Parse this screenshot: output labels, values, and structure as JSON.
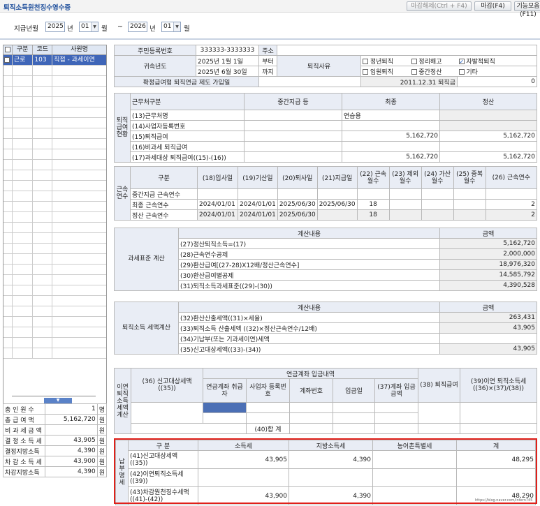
{
  "title": "퇴직소득원천징수영수증",
  "buttons": {
    "cancel_close": "마감해제(Ctrl + F4)",
    "close": "마감(F4)",
    "functions": "기능모음(F11)"
  },
  "period": {
    "label": "지급년월",
    "from_year": "2025",
    "year_unit": "년",
    "from_month": "01",
    "month_unit": "월",
    "tilde": "~",
    "to_year": "2026",
    "to_month": "01"
  },
  "list": {
    "headers": [
      "구분",
      "코드",
      "사원명"
    ],
    "rows": [
      {
        "type": "근로",
        "code": "103",
        "name": "직접 - 과세이연"
      }
    ]
  },
  "summary": [
    {
      "label": "총 인 원 수",
      "value": "1",
      "unit": "명"
    },
    {
      "label": "총 급 여 액",
      "value": "5,162,720",
      "unit": "원"
    },
    {
      "label": "비 과 세 금 액",
      "value": "",
      "unit": "원"
    },
    {
      "label": "결 정 소 득 세",
      "value": "43,905",
      "unit": "원"
    },
    {
      "label": "결정지방소득",
      "value": "4,390",
      "unit": "원"
    },
    {
      "label": "차 감 소 득 세",
      "value": "43,900",
      "unit": "원"
    },
    {
      "label": "차감지방소득",
      "value": "4,390",
      "unit": "원"
    }
  ],
  "top": {
    "resident_no_label": "주민등록번호",
    "resident_no": "333333-3333333",
    "address_label": "주소",
    "year_label": "귀속년도",
    "start_date": "2025년 1월 1일",
    "start_suffix": "부터",
    "end_date": "2025년 6월 30일",
    "end_suffix": "까지",
    "reason_label": "퇴직사유",
    "reasons": [
      {
        "label": "정년퇴직",
        "checked": false
      },
      {
        "label": "정리해고",
        "checked": false
      },
      {
        "label": "자발적퇴직",
        "checked": true
      },
      {
        "label": "임원퇴직",
        "checked": false
      },
      {
        "label": "중간정산",
        "checked": false
      },
      {
        "label": "기타",
        "checked": false
      }
    ],
    "pension_label": "확정급여형 퇴직연금 제도 가입일",
    "pension_date_text": "2011.12.31 퇴직금",
    "pension_amount": "0"
  },
  "status": {
    "side": "퇴직급여현황",
    "h_workplace": "근무처구분",
    "h_interim": "중간지급 등",
    "h_final": "최종",
    "h_settle": "정산",
    "rows": [
      {
        "label": "(13)근무처명",
        "interim": "",
        "final": "연습용",
        "settle": ""
      },
      {
        "label": "(14)사업자등록번호",
        "interim": "",
        "final": "",
        "settle": ""
      },
      {
        "label": "(15)퇴직급여",
        "interim": "",
        "final": "5,162,720",
        "settle": "5,162,720"
      },
      {
        "label": "(16)비과세 퇴직급여",
        "interim": "",
        "final": "",
        "settle": ""
      },
      {
        "label": "(17)과세대상 퇴직급여((15)-(16))",
        "interim": "",
        "final": "5,162,720",
        "settle": "5,162,720"
      }
    ]
  },
  "tenure": {
    "side": "근속연수",
    "h_category": "구분",
    "cols": [
      "(18)입사일",
      "(19)기산일",
      "(20)퇴사일",
      "(21)지급일",
      "(22) 근속월수",
      "(23) 제외월수",
      "(24) 가산월수",
      "(25) 중복월수",
      "(26) 근속연수"
    ],
    "rows": [
      {
        "label": "중간지급 근속연수",
        "vals": [
          "",
          "",
          "",
          "",
          "",
          "",
          "",
          "",
          ""
        ]
      },
      {
        "label": "최종 근속연수",
        "vals": [
          "2024/01/01",
          "2024/01/01",
          "2025/06/30",
          "2025/06/30",
          "18",
          "",
          "",
          "",
          "2"
        ]
      },
      {
        "label": "정산 근속연수",
        "vals": [
          "2024/01/01",
          "2024/01/01",
          "2025/06/30",
          "",
          "18",
          "",
          "",
          "",
          "2"
        ]
      }
    ]
  },
  "taxbase": {
    "side": "과세표준 계산",
    "h_content": "계산내용",
    "h_amount": "금액",
    "rows": [
      {
        "label": "(27)정산퇴직소득=(17)",
        "amount": "5,162,720"
      },
      {
        "label": "(28)근속연수공제",
        "amount": "2,000,000"
      },
      {
        "label": "(29)환산급여[(27-28)X12배/정산근속연수]",
        "amount": "18,976,320"
      },
      {
        "label": "(30)환산급여별공제",
        "amount": "14,585,792"
      },
      {
        "label": "(31)퇴직소득과세표준((29)-(30))",
        "amount": "4,390,528"
      }
    ]
  },
  "taxcalc": {
    "side": "퇴직소득 세액계산",
    "h_content": "계산내용",
    "h_amount": "금액",
    "rows": [
      {
        "label": "(32)환산산출세액((31)×세율)",
        "amount": "263,431"
      },
      {
        "label": "(33)퇴직소득 산출세액 ((32)×정산근속연수/12배)",
        "amount": "43,905"
      },
      {
        "label": "(34)기납부(또는 기과세이연)세액",
        "amount": ""
      },
      {
        "label": "(35)신고대상세액((33)-(34))",
        "amount": "43,905"
      }
    ]
  },
  "deferral": {
    "side": "이연퇴직소득세액계산",
    "h_report": "(36) 신고대상세액 ((35))",
    "h_group": "연금계좌 입금내역",
    "h_cols": [
      "연금계좌 취급자",
      "사업자 등록번호",
      "계좌번호",
      "입금일",
      "(37)계좌 입금금액"
    ],
    "h_38": "(38) 퇴직급여",
    "h_39": "(39)이연 퇴직소득세 ((36)×(37)/(38))",
    "total_label": "(40)합 계"
  },
  "payment": {
    "side": "납부명세",
    "h_category": "구 분",
    "h_cols": [
      "소득세",
      "지방소득세",
      "농어촌특별세",
      "계"
    ],
    "rows": [
      {
        "label": "(41)신고대상세액 ((35))",
        "vals": [
          "43,905",
          "4,390",
          "",
          "48,295"
        ]
      },
      {
        "label": "(42)이연퇴직소득세 ((39))",
        "vals": [
          "",
          "",
          "",
          ""
        ]
      },
      {
        "label": "(43)차감원천징수세액 ((41)-(42))",
        "vals": [
          "43,900",
          "4,390",
          "",
          "48,290"
        ]
      }
    ]
  },
  "watermark": "https://blog.naver.com/intern745"
}
